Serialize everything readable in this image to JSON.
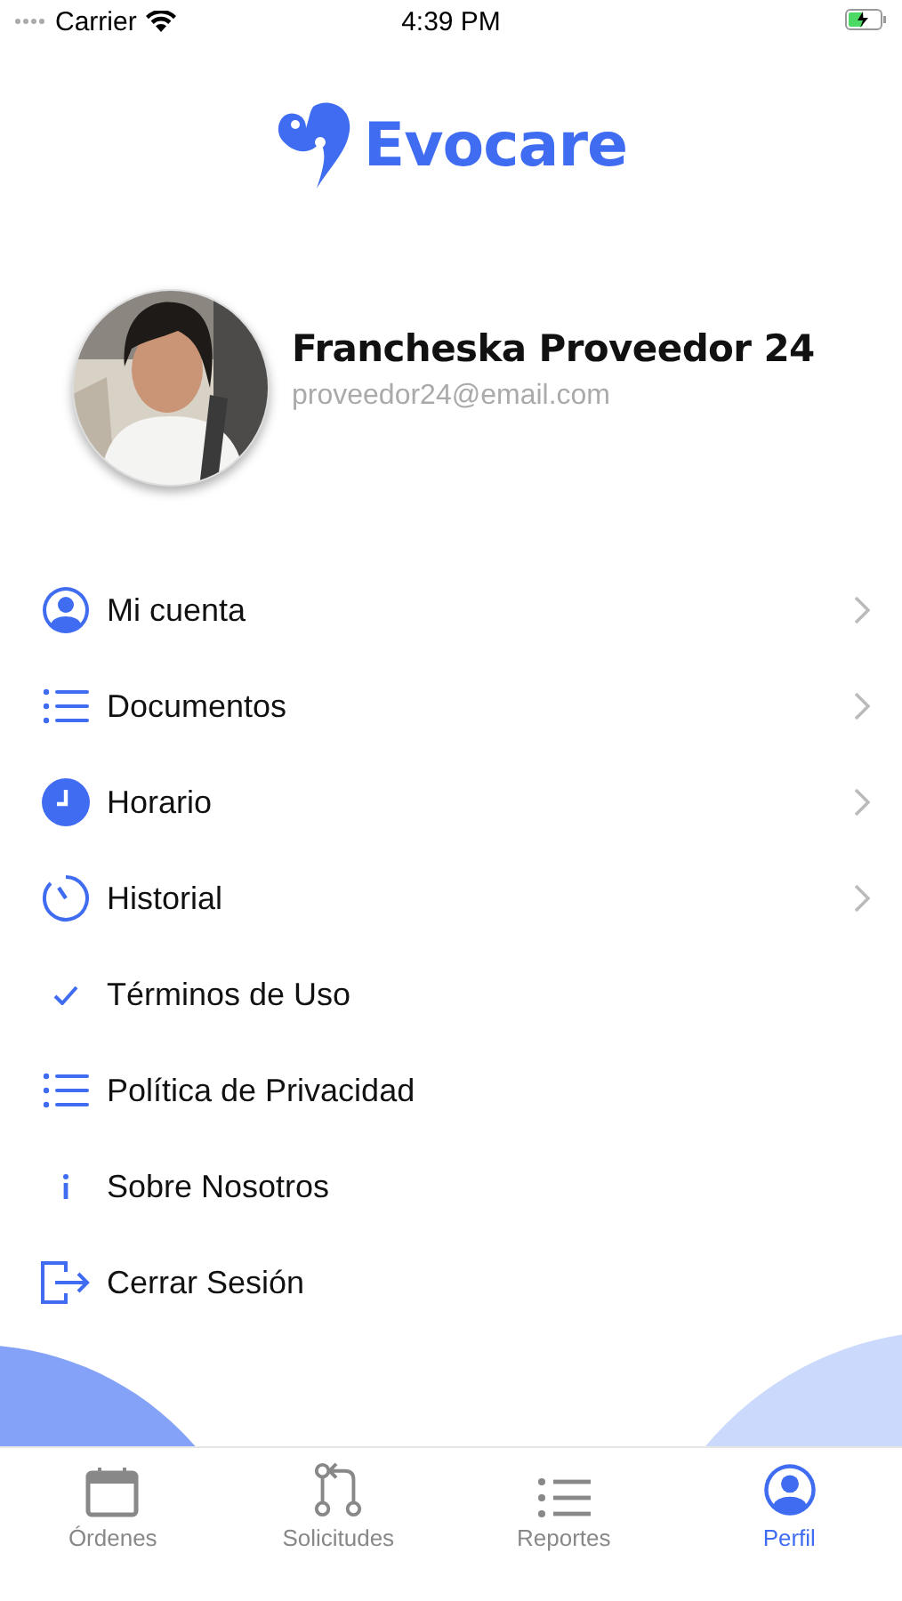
{
  "status_bar": {
    "carrier": "Carrier",
    "time": "4:39 PM"
  },
  "logo": {
    "text": "Evocare"
  },
  "profile": {
    "name": "Francheska Proveedor 24",
    "email": "proveedor24@email.com"
  },
  "menu": [
    {
      "label": "Mi cuenta",
      "kind": "person",
      "chevron": true
    },
    {
      "label": "Documentos",
      "kind": "list",
      "chevron": true
    },
    {
      "label": "Horario",
      "kind": "clock",
      "chevron": true
    },
    {
      "label": "Historial",
      "kind": "timer",
      "chevron": true
    },
    {
      "label": "Términos de Uso",
      "kind": "check",
      "chevron": false
    },
    {
      "label": "Política de Privacidad",
      "kind": "list",
      "chevron": false
    },
    {
      "label": "Sobre Nosotros",
      "kind": "info",
      "chevron": false
    },
    {
      "label": "Cerrar Sesión",
      "kind": "logout",
      "chevron": false
    }
  ],
  "tabs": [
    {
      "label": "Órdenes",
      "kind": "calendar",
      "selected": false
    },
    {
      "label": "Solicitudes",
      "kind": "merge",
      "selected": false
    },
    {
      "label": "Reportes",
      "kind": "list",
      "selected": false
    },
    {
      "label": "Perfil",
      "kind": "person",
      "selected": true
    }
  ]
}
